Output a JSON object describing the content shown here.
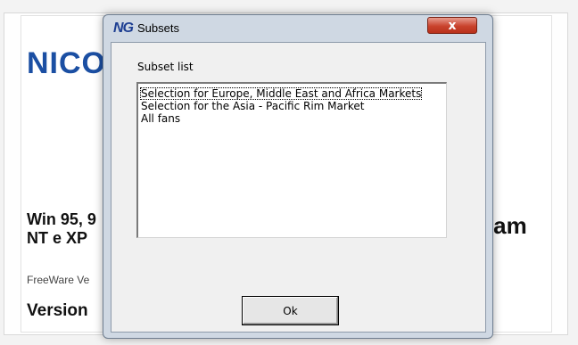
{
  "background_app": {
    "brand_fragment": "NICO",
    "platform_line1": "Win 95, 9",
    "platform_line2": "NT e XP",
    "freeware_fragment": "FreeWare Ve",
    "version_fragment": "Version",
    "right_fragment": "ram"
  },
  "dialog": {
    "title": "Subsets",
    "app_icon_text": "NG",
    "close_label": "x",
    "group_label": "Subset list",
    "items": [
      {
        "label": "Selection for Europe, Middle East and Africa Markets",
        "selected": true
      },
      {
        "label": "Selection for the Asia - Pacific Rim Market",
        "selected": false
      },
      {
        "label": "All fans",
        "selected": false
      }
    ],
    "ok_label": "Ok"
  },
  "colors": {
    "brand": "#1b4fa3",
    "dialog_frame": "#cfd8e3",
    "close_button": "#c9432d"
  }
}
